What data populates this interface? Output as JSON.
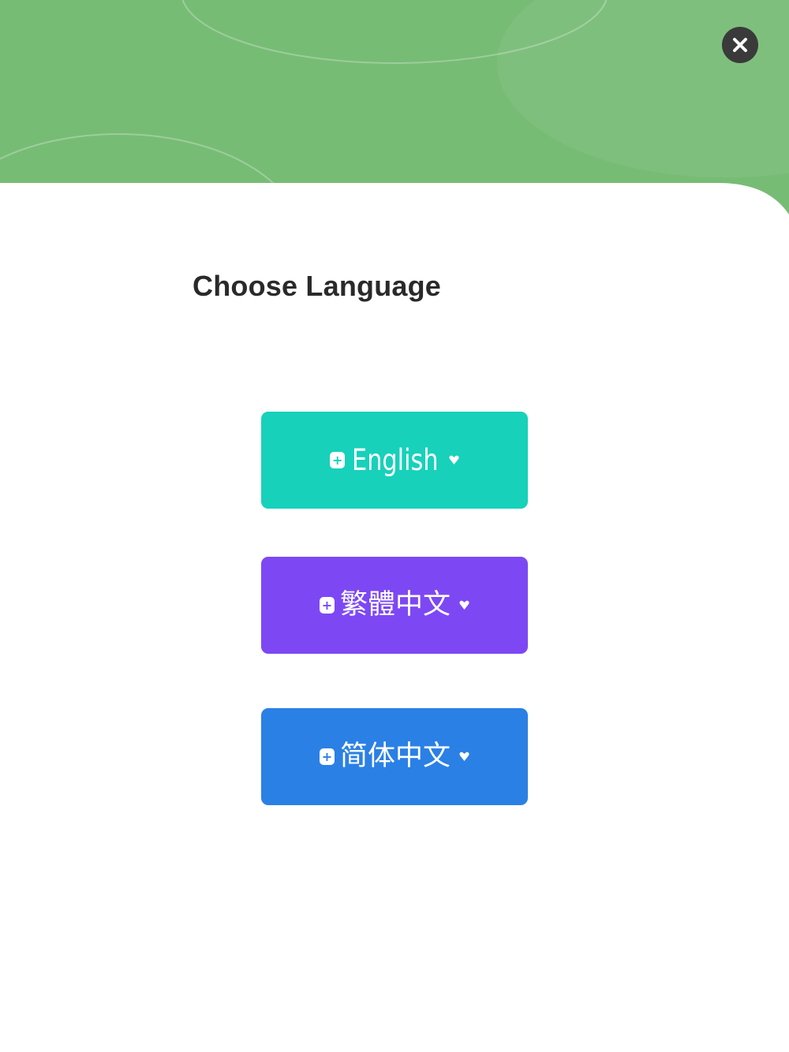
{
  "screen": {
    "title": "Choose Language"
  },
  "languages": [
    {
      "label": "English",
      "color": "#17d1bb",
      "icon_left": "plus-square-icon",
      "icon_right": "heart-icon"
    },
    {
      "label": "繁體中文",
      "color": "#7d48f4",
      "icon_left": "plus-square-icon",
      "icon_right": "heart-icon"
    },
    {
      "label": "简体中文",
      "color": "#2b80e5",
      "icon_left": "plus-square-icon",
      "icon_right": "heart-icon"
    }
  ],
  "theme": {
    "header_green": "#78bd76",
    "close_button": "#3a3a3a",
    "title_color": "#2a2a2a"
  },
  "icons": {
    "close": "close-icon",
    "plus": "+"
  }
}
